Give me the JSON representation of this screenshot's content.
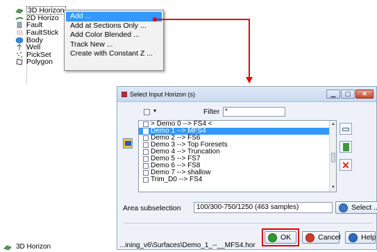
{
  "tree": {
    "items": [
      {
        "label": "3D Horizon",
        "icon": "horizon-3d-icon",
        "selected": true
      },
      {
        "label": "2D Horizo",
        "icon": "horizon-2d-icon"
      },
      {
        "label": "Fault",
        "icon": "fault-icon"
      },
      {
        "label": "FaultStick",
        "icon": "faultstick-icon"
      },
      {
        "label": "Body",
        "icon": "body-icon"
      },
      {
        "label": "Well",
        "icon": "well-icon"
      },
      {
        "label": "PickSet",
        "icon": "pickset-icon"
      },
      {
        "label": "Polygon",
        "icon": "polygon-icon"
      }
    ]
  },
  "context_menu": {
    "items": [
      "Add ...",
      "Add at Sections Only ...",
      "Add Color Blended ...",
      "Track New ...",
      "Create with Constant Z ..."
    ],
    "active_index": 0
  },
  "dialog": {
    "title": "Select Input Horizon (s)",
    "filter_label": "Filter",
    "filter_value": "*",
    "list_items": [
      "> Demo 0 --> FS4 <",
      "Demo 1 --> MFS4",
      "Demo 2 --> FS6",
      "Demo 3  --> Top Foresets",
      "Demo 4 --> Truncation",
      "Demo 5 --> FS7",
      "Demo 6 --> FS8",
      "Demo 7 --> shallow",
      "Trim_D0 --> FS4"
    ],
    "selected_index": 1,
    "area_label": "Area subselection",
    "area_value": "100/300-750/1250 (463 samples)",
    "select_label": "Select ...",
    "ok_label": "OK",
    "cancel_label": "Cancel",
    "help_label": "Help"
  },
  "status_path": "...ining_v6\\Surfaces\\Demo_1_--__MFS4.hor",
  "bottom_tree_label": "3D Horizon",
  "colors": {
    "accent": "#3399ff",
    "annotation": "#e60000"
  }
}
